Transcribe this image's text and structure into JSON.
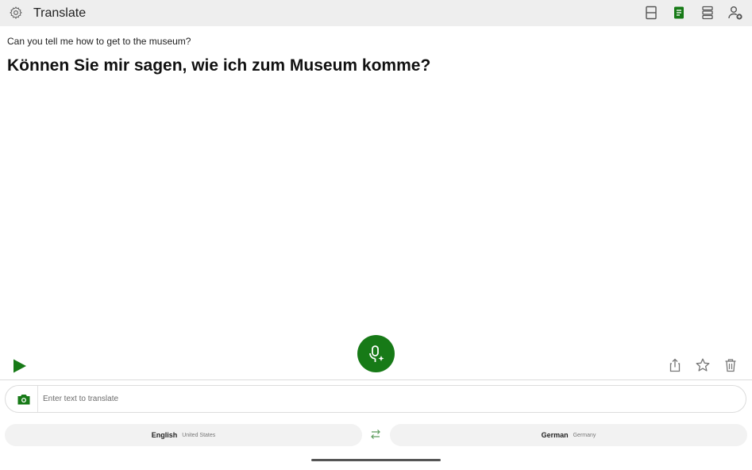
{
  "app": {
    "title": "Translate"
  },
  "toolbar": {
    "icons": [
      "gear-icon",
      "single-pane-layout-icon",
      "note-icon",
      "list-layout-icon",
      "add-person-icon"
    ],
    "active_icon_color": "#177a17"
  },
  "conversation": {
    "source_text": "Can you tell me how to get to the museum?",
    "translated_text": "Können Sie mir sagen, wie ich zum Museum komme?"
  },
  "controls": {
    "play_icon": "play-icon",
    "mic_icon": "mic-sparkle-icon",
    "actions": [
      "share-icon",
      "star-icon",
      "trash-icon"
    ]
  },
  "input": {
    "placeholder": "Enter text to translate",
    "value": ""
  },
  "languages": {
    "source": {
      "name": "English",
      "region": "United States"
    },
    "target": {
      "name": "German",
      "region": "Germany"
    }
  },
  "colors": {
    "accent": "#177a17",
    "topbar": "#eeeeee"
  }
}
